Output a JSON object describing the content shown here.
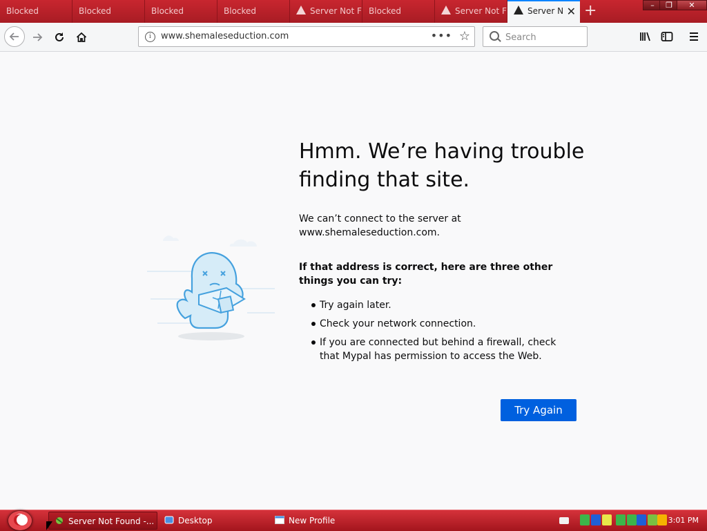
{
  "browser": {
    "tabs": [
      {
        "label": "Blocked",
        "warning": false,
        "active": false
      },
      {
        "label": "Blocked",
        "warning": false,
        "active": false
      },
      {
        "label": "Blocked",
        "warning": false,
        "active": false
      },
      {
        "label": "Blocked",
        "warning": false,
        "active": false
      },
      {
        "label": "Server Not F",
        "warning": true,
        "active": false
      },
      {
        "label": "Blocked",
        "warning": false,
        "active": false
      },
      {
        "label": "Server Not F",
        "warning": true,
        "active": false
      },
      {
        "label": "Server N",
        "warning": true,
        "active": true
      }
    ],
    "new_tab_label": "+",
    "window": {
      "minimize": "–",
      "maximize": "❐",
      "close": "✕"
    }
  },
  "nav": {
    "url": "www.shemaleseduction.com",
    "page_actions": "•••",
    "bookmark_star": "☆",
    "search_placeholder": "Search",
    "icons": [
      "back-arrow-icon",
      "forward-arrow-icon",
      "reload-icon",
      "home-icon",
      "library-icon",
      "sidebar-icon",
      "menu-icon"
    ]
  },
  "error_page": {
    "title": "Hmm. We’re having trouble finding that site.",
    "description": "We can’t connect to the server at www.shemaleseduction.com.",
    "subtitle": "If that address is correct, here are three other things you can try:",
    "tips": [
      "Try again later.",
      "Check your network connection.",
      "If you are connected but behind a firewall, check that Mypal has permission to access the Web."
    ],
    "button_label": "Try Again",
    "accent_color": "#0060df"
  },
  "taskbar": {
    "items": [
      {
        "label": "Server Not Found -...",
        "active": true
      },
      {
        "label": "Desktop",
        "active": false
      },
      {
        "label": "New Profile",
        "active": false
      }
    ],
    "clock": "3:01 PM",
    "tray_colors": [
      "#f2f2f2",
      "#3db54a",
      "#1f5fd6",
      "#e8e84a",
      "#3db54a",
      "#3db54a",
      "#1f5fd6",
      "#7ac142",
      "#f5b400"
    ]
  }
}
